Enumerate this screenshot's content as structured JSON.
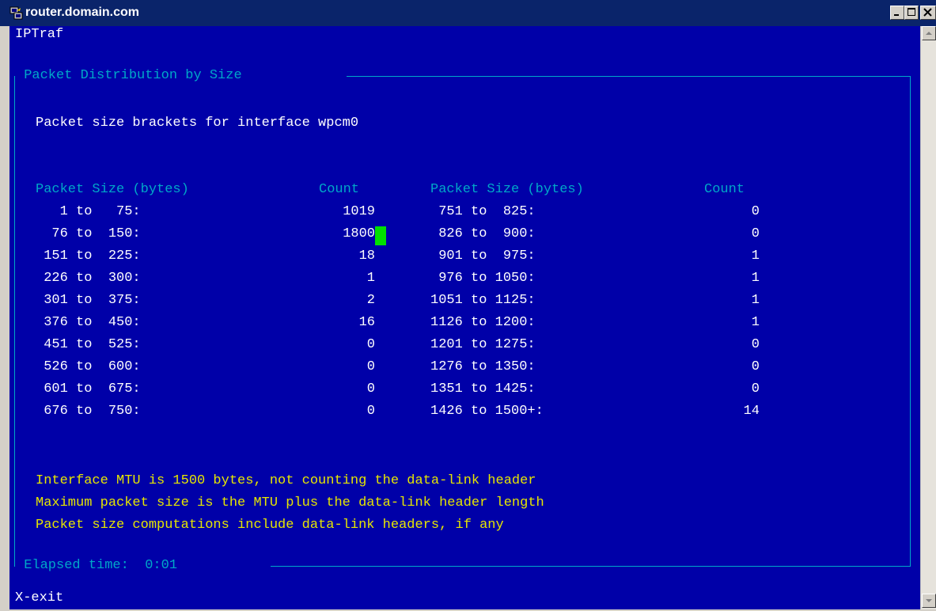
{
  "window": {
    "title": "router.domain.com",
    "icons": [
      "putty-icon",
      "minimize-icon",
      "maximize-icon",
      "close-icon"
    ]
  },
  "colors": {
    "terminal_bg": "#0000a8",
    "text_yellow": "#e6e600",
    "text_cyan": "#00a8c8",
    "text_white": "#ffffff",
    "cursor": "#00e000",
    "titlebar": "#0a246a"
  },
  "app": {
    "name": "IPTraf",
    "panel_title": "Packet Distribution by Size",
    "intro": "Packet size brackets for interface wpcm0",
    "headers": {
      "left_size": "Packet Size (bytes)",
      "left_count": "Count",
      "right_size": "Packet Size (bytes)",
      "right_count": "Count"
    },
    "rows": [
      {
        "left_size": "   1 to   75:",
        "left_count": "1019",
        "right_size": " 751 to  825:",
        "right_count": "0"
      },
      {
        "left_size": "  76 to  150:",
        "left_count": "1800",
        "right_size": " 826 to  900:",
        "right_count": "0"
      },
      {
        "left_size": " 151 to  225:",
        "left_count": "18",
        "right_size": " 901 to  975:",
        "right_count": "1"
      },
      {
        "left_size": " 226 to  300:",
        "left_count": "1",
        "right_size": " 976 to 1050:",
        "right_count": "1"
      },
      {
        "left_size": " 301 to  375:",
        "left_count": "2",
        "right_size": "1051 to 1125:",
        "right_count": "1"
      },
      {
        "left_size": " 376 to  450:",
        "left_count": "16",
        "right_size": "1126 to 1200:",
        "right_count": "1"
      },
      {
        "left_size": " 451 to  525:",
        "left_count": "0",
        "right_size": "1201 to 1275:",
        "right_count": "0"
      },
      {
        "left_size": " 526 to  600:",
        "left_count": "0",
        "right_size": "1276 to 1350:",
        "right_count": "0"
      },
      {
        "left_size": " 601 to  675:",
        "left_count": "0",
        "right_size": "1351 to 1425:",
        "right_count": "0"
      },
      {
        "left_size": " 676 to  750:",
        "left_count": "0",
        "right_size": "1426 to 1500+:",
        "right_count": "14"
      }
    ],
    "notes": [
      "Interface MTU is 1500 bytes, not counting the data-link header",
      "Maximum packet size is the MTU plus the data-link header length",
      "Packet size computations include data-link headers, if any"
    ],
    "elapsed_label": "Elapsed time:",
    "elapsed_value": "0:01",
    "exit_hint": "X-exit"
  }
}
